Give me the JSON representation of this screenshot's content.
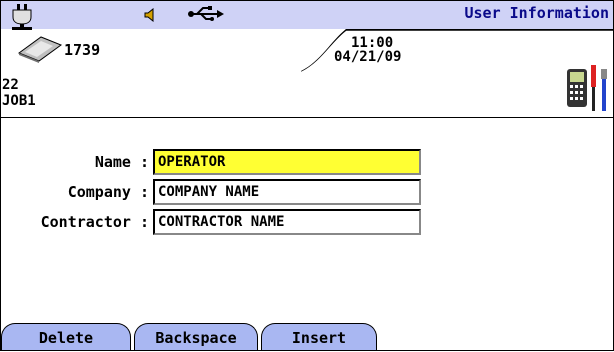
{
  "header": {
    "title": "User Information",
    "counter": "1739",
    "time": "11:00",
    "date": "04/21/09",
    "job_number": "22",
    "job_name": "JOB1"
  },
  "icons": {
    "power": "power-plug-icon",
    "speaker": "speaker-icon",
    "usb": "usb-icon",
    "device": "tester-device-icon",
    "tools": "tester-tools-icon"
  },
  "form": {
    "name": {
      "label": "Name",
      "value": "OPERATOR"
    },
    "company": {
      "label": "Company",
      "value": "COMPANY NAME"
    },
    "contractor": {
      "label": "Contractor",
      "value": "CONTRACTOR NAME"
    }
  },
  "softkeys": [
    "Delete",
    "Backspace",
    "Insert"
  ],
  "colors": {
    "header_band": "#cfd2f6",
    "active_field": "#ffff33",
    "softkey": "#a9b7f2",
    "title_text": "#0a0a8a"
  }
}
